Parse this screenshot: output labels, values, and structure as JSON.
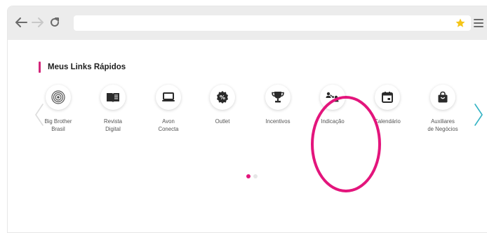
{
  "browser": {
    "back_icon": "arrow-left-icon",
    "forward_icon": "arrow-right-icon",
    "reload_icon": "reload-icon",
    "address_value": "",
    "bookmark_icon": "star-icon",
    "menu_icon": "hamburger-menu-icon"
  },
  "section": {
    "title": "Meus Links Rápidos",
    "accent_color": "#d3257a"
  },
  "carousel": {
    "items": [
      {
        "id": "bbb",
        "label": "Big Brother\nBrasil",
        "icon": "eye-icon"
      },
      {
        "id": "revista",
        "label": "Revista\nDigital",
        "icon": "book-icon"
      },
      {
        "id": "avon-conecta",
        "label": "Avon\nConecta",
        "icon": "laptop-icon"
      },
      {
        "id": "outlet",
        "label": "Outlet",
        "icon": "percent-badge-icon"
      },
      {
        "id": "incentivos",
        "label": "Incentivos",
        "icon": "trophy-icon"
      },
      {
        "id": "indicacao",
        "label": "Indicação",
        "icon": "referral-icon"
      },
      {
        "id": "calendario",
        "label": "Calendário",
        "icon": "calendar-icon"
      },
      {
        "id": "auxiliares",
        "label": "Auxiliares\nde Negócios",
        "icon": "shopping-bag-icon"
      }
    ],
    "pagination": {
      "active_index": 0,
      "total": 2,
      "active_color": "#e3157c",
      "inactive_color": "#e6e6e6"
    },
    "arrow_color_left": "#dcdcdc",
    "arrow_color_right": "#33b3c4"
  },
  "highlight": {
    "target": "Indicação",
    "color": "#e3157c"
  }
}
